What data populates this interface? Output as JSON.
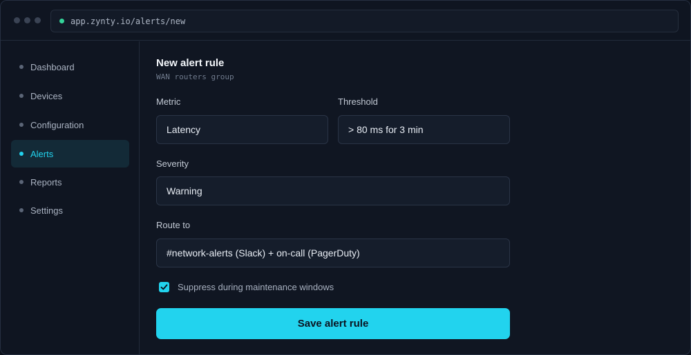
{
  "browser": {
    "url": "app.zynty.io/alerts/new"
  },
  "sidebar": {
    "items": [
      {
        "label": "Dashboard"
      },
      {
        "label": "Devices"
      },
      {
        "label": "Configuration"
      },
      {
        "label": "Alerts",
        "active": true
      },
      {
        "label": "Reports"
      },
      {
        "label": "Settings"
      }
    ]
  },
  "form": {
    "title": "New alert rule",
    "subtitle": "WAN routers group",
    "metric": {
      "label": "Metric",
      "value": "Latency"
    },
    "threshold": {
      "label": "Threshold",
      "value": "> 80 ms for 3 min"
    },
    "severity": {
      "label": "Severity",
      "value": "Warning"
    },
    "route": {
      "label": "Route to",
      "value": "#network-alerts (Slack) + on-call (PagerDuty)"
    },
    "suppress": {
      "label": "Suppress during maintenance windows",
      "checked": true
    },
    "save_label": "Save alert rule"
  },
  "colors": {
    "accent": "#22d3ee",
    "status_dot": "#34d399"
  }
}
